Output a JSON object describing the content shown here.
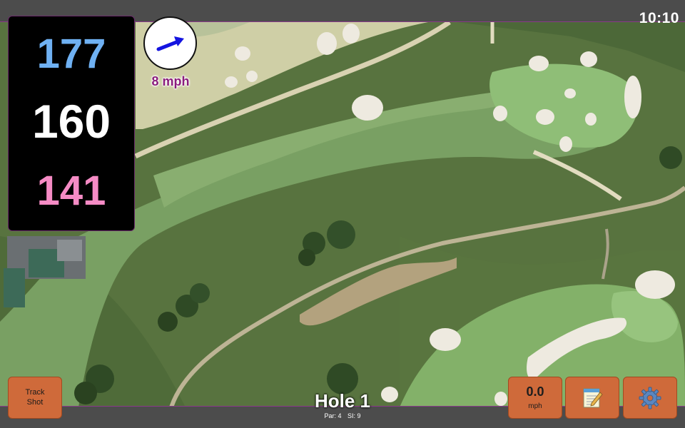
{
  "status": {
    "time": "10:10"
  },
  "distances": {
    "front": "177",
    "center": "160",
    "back": "141"
  },
  "wind": {
    "speed": "8 mph",
    "arrow_icon": "wind-direction-arrow-icon"
  },
  "hole": {
    "title": "Hole 1",
    "par": "Par: 4",
    "stroke_index": "SI: 9"
  },
  "buttons": {
    "track_shot": "Track\nShot",
    "track_shot_line1": "Track",
    "track_shot_line2": "Shot",
    "speed_value": "0.0",
    "speed_unit": "mph",
    "notes_icon": "notepad-icon",
    "settings_icon": "gear-icon"
  },
  "colors": {
    "front_distance": "#6fb1f3",
    "center_distance": "#ffffff",
    "back_distance": "#f58bc5",
    "button": "#cf6a3a",
    "wind_text": "#8b1d7d",
    "panel": "#000000"
  }
}
